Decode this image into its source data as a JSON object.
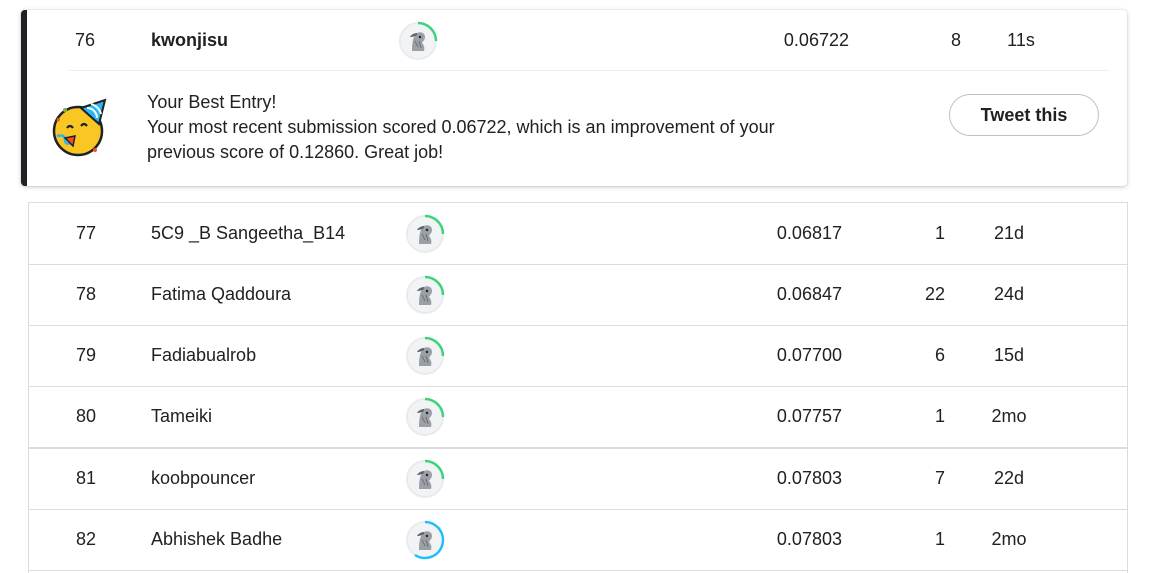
{
  "highlight": {
    "rank": "76",
    "team": "kwonjisu",
    "score": "0.06722",
    "entries": "8",
    "last": "11s",
    "best_title": "Your Best Entry!",
    "best_line1": "Your most recent submission scored 0.06722, which is an improvement of your",
    "best_line2": "previous score of 0.12860. Great job!",
    "tweet_label": "Tweet this"
  },
  "rows": [
    {
      "rank": "77",
      "team": "5C9 _B Sangeetha_B14",
      "score": "0.06817",
      "entries": "1",
      "last": "21d",
      "ring_color": "#20beff"
    },
    {
      "rank": "78",
      "team": "Fatima Qaddoura",
      "score": "0.06847",
      "entries": "22",
      "last": "24d",
      "ring_color": "#20beff"
    },
    {
      "rank": "79",
      "team": "Fadiabualrob",
      "score": "0.07700",
      "entries": "6",
      "last": "15d",
      "ring_color": "#20beff"
    },
    {
      "rank": "80",
      "team": "Tameiki",
      "score": "0.07757",
      "entries": "1",
      "last": "2mo",
      "ring_color": "#20beff"
    },
    {
      "rank": "81",
      "team": "koobpouncer",
      "score": "0.07803",
      "entries": "7",
      "last": "22d",
      "ring_color": "#20beff"
    },
    {
      "rank": "82",
      "team": "Abhishek Badhe",
      "score": "0.07803",
      "entries": "1",
      "last": "2mo",
      "ring_color": "#20beff"
    }
  ],
  "colors": {
    "ring_green": "#3dd37a",
    "ring_blue": "#20beff"
  }
}
